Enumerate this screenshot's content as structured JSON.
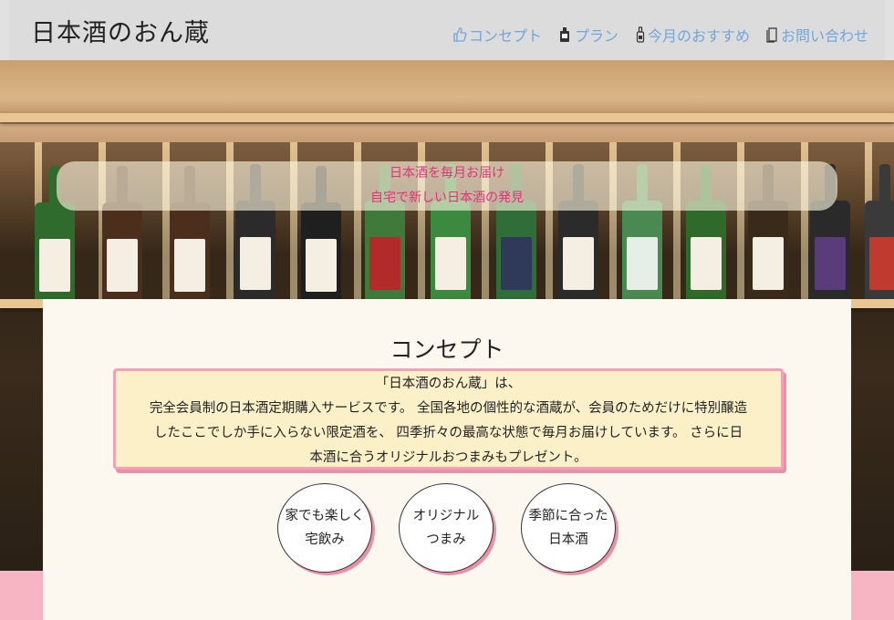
{
  "header": {
    "logo": "日本酒のおん蔵",
    "nav": [
      {
        "label": "コンセプト",
        "icon": "thumbs-up-icon"
      },
      {
        "label": "プラン",
        "icon": "sake-bottle-icon"
      },
      {
        "label": "今月のおすすめ",
        "icon": "bottle-icon"
      },
      {
        "label": "お問い合わせ",
        "icon": "document-icon"
      }
    ],
    "nav_color": "#6fa6dd"
  },
  "hero": {
    "tagline_1": "日本酒を毎月お届け",
    "tagline_2": "自宅で新しい日本酒の発見",
    "tagline_color": "#e2327a"
  },
  "concept": {
    "title": "コンセプト",
    "lines": [
      "「日本酒のおん蔵」は、",
      "完全会員制の日本酒定期購入サービスです。 全国各地の個性的な酒蔵が、会員のためだけに特別醸造",
      "したここでしか手に入らない限定酒を、 四季折々の最高な状態で毎月お届けしています。 さらに日",
      "本酒に合うオリジナルおつまみもプレゼント。"
    ],
    "circles": [
      {
        "line1": "家でも楽しく",
        "line2": "宅飲み"
      },
      {
        "line1": "オリジナル",
        "line2": "つまみ"
      },
      {
        "line1": "季節に合った",
        "line2": "日本酒"
      }
    ],
    "accent_color": "#f2a2b7"
  }
}
